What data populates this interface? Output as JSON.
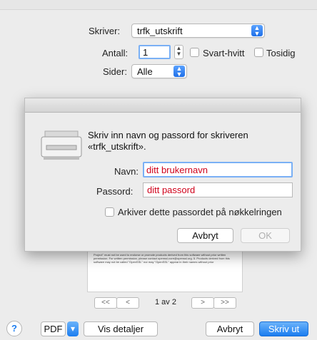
{
  "print": {
    "printer_label": "Skriver:",
    "printer_value": "trfk_utskrift",
    "copies_label": "Antall:",
    "copies_value": "1",
    "bw_label": "Svart-hvitt",
    "twosided_label": "Tosidig",
    "pages_label": "Sider:",
    "pages_value": "Alle"
  },
  "auth_sheet": {
    "message": "Skriv inn navn og passord for skriveren «trfk_utskrift».",
    "name_label": "Navn:",
    "name_value": "ditt brukernavn",
    "password_label": "Passord:",
    "password_value": "ditt passord",
    "remember_label": "Arkiver dette passordet på nøkkelringen",
    "cancel_label": "Avbryt",
    "ok_label": "OK",
    "field_text_color": "#d0021b"
  },
  "preview": {
    "text": "Project\" must not be used to endorse or promote products derived from this software without prior written permission. For written permission, please contact openssl-core@openssl.org. 5. Products derived from this software may not be called \"OpenSSL\" nor may \"OpenSSL\" appear in their names without prior",
    "first_label": "<<",
    "prev_label": "<",
    "page_indicator": "1 av 2",
    "next_label": ">",
    "last_label": ">>"
  },
  "bottom": {
    "help_label": "?",
    "pdf_label": "PDF",
    "pdf_arrow": "▾",
    "details_label": "Vis detaljer",
    "cancel_label": "Avbryt",
    "print_label": "Skriv ut"
  },
  "colors": {
    "accent": "#1b7df0",
    "field_text": "#d0021b"
  }
}
